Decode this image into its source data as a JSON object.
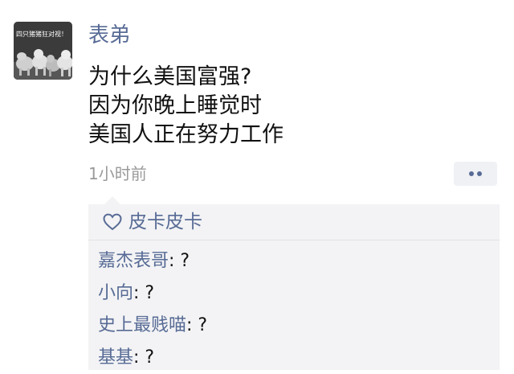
{
  "post": {
    "author": "表弟",
    "avatar_caption": "四只猪猪狂对视！",
    "content_lines": [
      "为什么美国富强?",
      "因为你晚上睡觉时",
      "美国人正在努力工作"
    ],
    "timestamp": "1小时前",
    "more_icon": "more-dots-icon"
  },
  "likes": {
    "icon": "heart-outline-icon",
    "names": "皮卡皮卡"
  },
  "comments": [
    {
      "author": "嘉杰表哥",
      "separator": ": ",
      "text": "?"
    },
    {
      "author": "小向",
      "separator": ": ",
      "text": "?"
    },
    {
      "author": "史上最贱喵",
      "separator": ": ",
      "text": "?"
    },
    {
      "author": "基基",
      "separator": ": ",
      "text": "?"
    }
  ],
  "colors": {
    "link": "#576b95",
    "text": "#111111",
    "muted": "#9a9a9a",
    "panel": "#f3f3f5"
  }
}
